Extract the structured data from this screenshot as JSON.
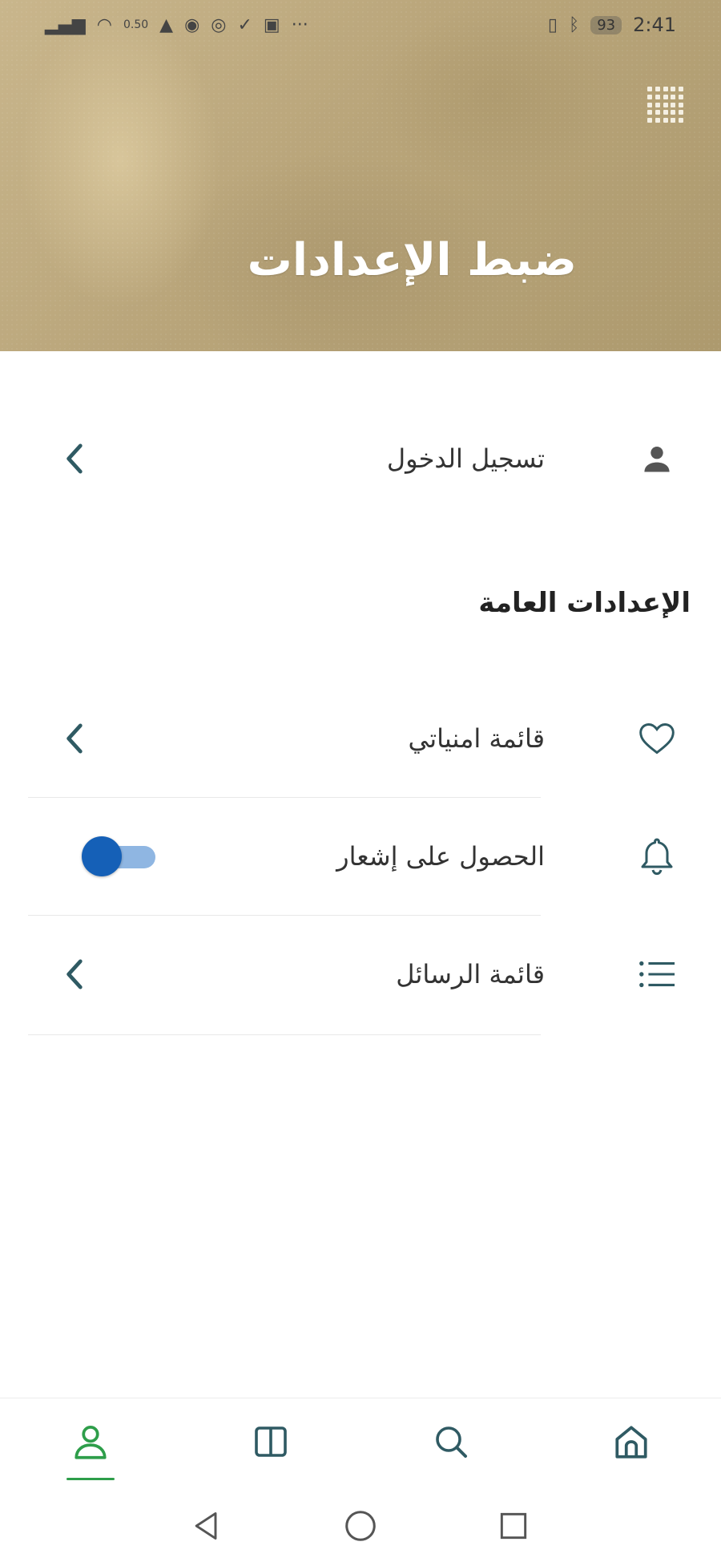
{
  "status_bar": {
    "time": "2:41",
    "battery": "93",
    "left_icons": [
      "signal-icon",
      "wifi-icon",
      "speed-icon",
      "flame-icon",
      "pinterest-icon",
      "instagram-icon",
      "check-icon",
      "gallery-icon",
      "more-icon"
    ],
    "speed_text": "0.50",
    "more_text": "···"
  },
  "header": {
    "title": "ضبط الإعدادات",
    "background_color": "#b9a57a"
  },
  "account": {
    "login_label": "تسجيل الدخول",
    "icon": "user-icon"
  },
  "general": {
    "section_title": "الإعدادات العامة",
    "items": [
      {
        "label": "قائمة امنياتي",
        "icon": "heart-icon",
        "control": "chevron"
      },
      {
        "label": "الحصول على إشعار",
        "icon": "bell-icon",
        "control": "toggle",
        "enabled": true
      },
      {
        "label": "قائمة الرسائل",
        "icon": "list-icon",
        "control": "chevron"
      }
    ]
  },
  "bottom_nav": {
    "items": [
      "profile-icon",
      "book-icon",
      "search-icon",
      "home-icon"
    ],
    "active": "profile-icon",
    "active_color": "#2e9e4a",
    "icon_color": "#2f5a63"
  },
  "system_nav": [
    "back-icon",
    "home-circle-icon",
    "recents-icon"
  ],
  "colors": {
    "toggle_knob": "#1560b7",
    "toggle_track": "#8fb6e2",
    "chevron": "#2f5a63"
  }
}
